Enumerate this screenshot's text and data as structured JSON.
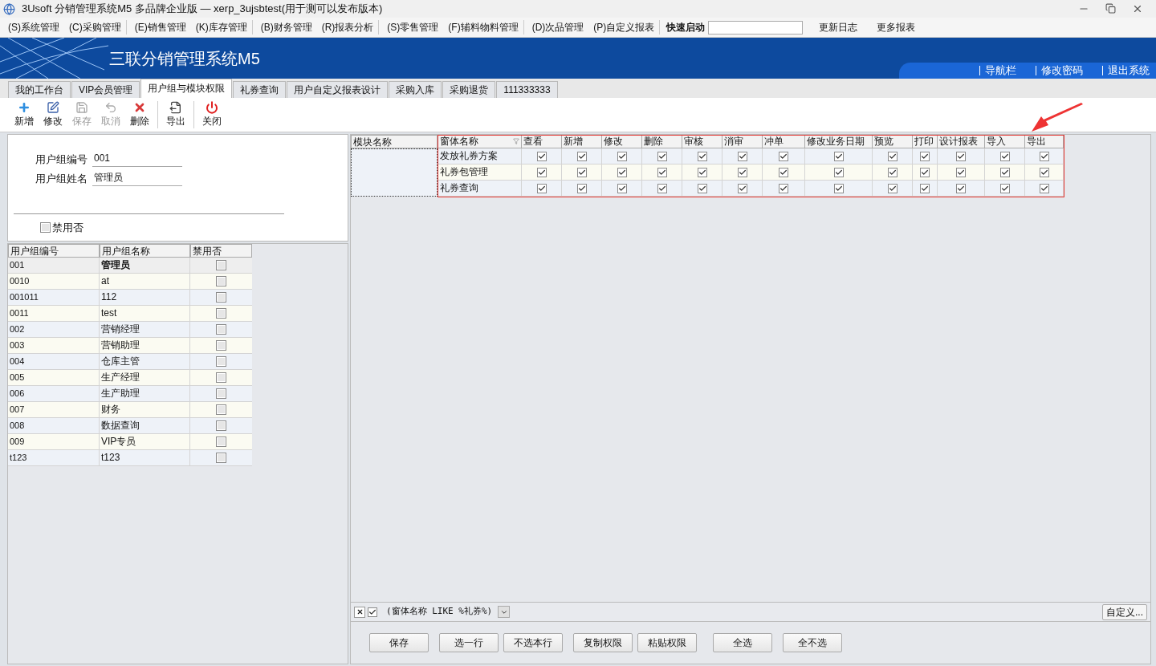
{
  "window": {
    "title": "3Usoft 分销管理系统M5 多品牌企业版 — xerp_3ujsbtest(用于测可以发布版本)"
  },
  "menu": [
    "(S)系统管理",
    "(C)采购管理",
    "(E)销售管理",
    "(K)库存管理",
    "(B)财务管理",
    "(R)报表分析",
    "(S)零售管理",
    "(F)辅料物料管理",
    "(D)次品管理",
    "(P)自定义报表"
  ],
  "quick_launch": {
    "label": "快速启动",
    "links": [
      "更新日志",
      "更多报表"
    ]
  },
  "banner": {
    "title": "三联分销管理系统M5",
    "links": [
      "导航栏",
      "修改密码",
      "退出系统"
    ]
  },
  "tabs": [
    {
      "label": "我的工作台",
      "selected": false
    },
    {
      "label": "VIP会员管理",
      "selected": false
    },
    {
      "label": "用户组与模块权限",
      "selected": true
    },
    {
      "label": "礼券查询",
      "selected": false
    },
    {
      "label": "用户自定义报表设计",
      "selected": false
    },
    {
      "label": "采购入库",
      "selected": false
    },
    {
      "label": "采购退货",
      "selected": false
    },
    {
      "label": "111333333",
      "selected": false
    }
  ],
  "toolbar": [
    {
      "kind": "add",
      "label": "新增",
      "disabled": false
    },
    {
      "kind": "edit",
      "label": "修改",
      "disabled": false
    },
    {
      "kind": "save",
      "label": "保存",
      "disabled": true
    },
    {
      "kind": "cancel",
      "label": "取消",
      "disabled": true
    },
    {
      "kind": "delete",
      "label": "删除",
      "disabled": false
    },
    {
      "kind": "export",
      "label": "导出",
      "disabled": false
    },
    {
      "kind": "close",
      "label": "关闭",
      "disabled": false
    }
  ],
  "form": {
    "fields": [
      {
        "label": "用户组编号",
        "value": "001"
      },
      {
        "label": "用户组姓名",
        "value": "管理员"
      }
    ],
    "disable": {
      "label": "禁用否",
      "checked": false
    }
  },
  "groups": {
    "columns": [
      "用户组编号",
      "用户组名称",
      "禁用否"
    ],
    "rows": [
      {
        "code": "001",
        "name": "管理员",
        "disabled": false,
        "selected": true
      },
      {
        "code": "0010",
        "name": "at",
        "disabled": false,
        "selected": false
      },
      {
        "code": "001011",
        "name": "112",
        "disabled": false,
        "selected": false
      },
      {
        "code": "0011",
        "name": "test",
        "disabled": false,
        "selected": false
      },
      {
        "code": "002",
        "name": "营销经理",
        "disabled": false,
        "selected": false
      },
      {
        "code": "003",
        "name": "营销助理",
        "disabled": false,
        "selected": false
      },
      {
        "code": "004",
        "name": "仓库主管",
        "disabled": false,
        "selected": false
      },
      {
        "code": "005",
        "name": "生产经理",
        "disabled": false,
        "selected": false
      },
      {
        "code": "006",
        "name": "生产助理",
        "disabled": false,
        "selected": false
      },
      {
        "code": "007",
        "name": "财务",
        "disabled": false,
        "selected": false
      },
      {
        "code": "008",
        "name": "数据查询",
        "disabled": false,
        "selected": false
      },
      {
        "code": "009",
        "name": "VIP专员",
        "disabled": false,
        "selected": false
      },
      {
        "code": "t123",
        "name": "t123",
        "disabled": false,
        "selected": false
      }
    ]
  },
  "permissions": {
    "module_column": "模块名称",
    "form_column": "窗体名称",
    "columns": [
      "查看",
      "新增",
      "修改",
      "删除",
      "审核",
      "消审",
      "冲单",
      "修改业务日期",
      "预览",
      "打印",
      "设计报表",
      "导入",
      "导出"
    ],
    "rows": [
      {
        "form": "发放礼券方案",
        "checks": [
          true,
          true,
          true,
          true,
          true,
          true,
          true,
          true,
          true,
          true,
          true,
          true,
          true
        ]
      },
      {
        "form": "礼券包管理",
        "checks": [
          true,
          true,
          true,
          true,
          true,
          true,
          true,
          true,
          true,
          true,
          true,
          true,
          true
        ]
      },
      {
        "form": "礼券查询",
        "checks": [
          true,
          true,
          true,
          true,
          true,
          true,
          true,
          true,
          true,
          true,
          true,
          true,
          true
        ]
      }
    ]
  },
  "filter": {
    "enabled": true,
    "text": "(窗体名称 LIKE %礼券%)",
    "customize": "自定义..."
  },
  "actions": [
    "保存",
    "选一行",
    "不选本行",
    "复制权限",
    "粘贴权限",
    "全选",
    "全不选"
  ]
}
